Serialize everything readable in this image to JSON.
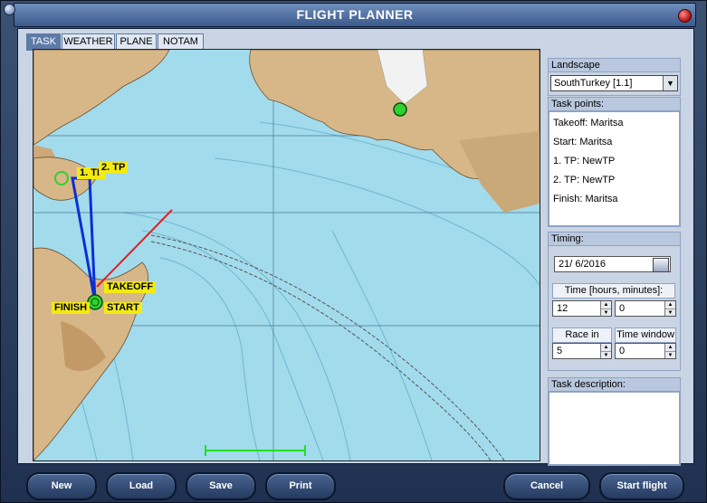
{
  "window": {
    "title": "FLIGHT PLANNER"
  },
  "tabs": [
    {
      "label": "TASK",
      "active": true
    },
    {
      "label": "WEATHER",
      "active": false
    },
    {
      "label": "PLANE",
      "active": false
    },
    {
      "label": "NOTAM",
      "active": false
    }
  ],
  "map": {
    "labels": {
      "takeoff": "TAKEOFF",
      "finish": "FINISH",
      "start": "START",
      "tp1": "1. TP",
      "tp2": "2. TP"
    },
    "colors": {
      "water": "#9fd9ea",
      "land": "#d9b98a",
      "route": "#0a2fd6",
      "heading": "#e02020",
      "label": "#f3ea12"
    }
  },
  "landscape": {
    "header": "Landscape",
    "selected": "SouthTurkey [1.1]"
  },
  "task_points": {
    "header": "Task points:",
    "items": [
      "Takeoff: Maritsa",
      "Start: Maritsa",
      "1. TP: NewTP",
      "2. TP: NewTP",
      "Finish: Maritsa"
    ]
  },
  "timing": {
    "header": "Timing:",
    "date": "21/ 6/2016",
    "time_label": "Time [hours, minutes]:",
    "hours": "12",
    "minutes": "0",
    "race_in_label": "Race in",
    "race_in": "5",
    "time_window_label": "Time window",
    "time_window": "0"
  },
  "task_description": {
    "header": "Task description:"
  },
  "buttons": {
    "new": "New",
    "load": "Load",
    "save": "Save",
    "print": "Print",
    "cancel": "Cancel",
    "start_flight": "Start flight"
  }
}
